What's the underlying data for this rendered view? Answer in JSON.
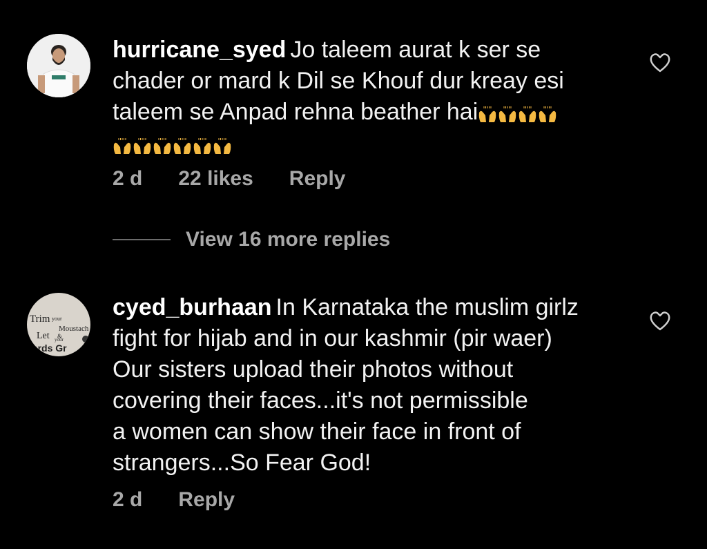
{
  "comments": [
    {
      "username": "hurricane_syed",
      "text": "Jo taleem aurat k ser se chader or mard k Dil se Khouf dur kreay esi taleem se Anpad rehna beather hai",
      "line1": "Jo taleem aurat k ser se",
      "line2": "chader or mard k Dil se Khouf dur kreay esi",
      "line3": "taleem se Anpad rehna beather hai",
      "emoji_count_line3": 4,
      "emoji_count_line4": 6,
      "emoji_name": "raising-hands-emoji",
      "time": "2 d",
      "likes": "22 likes",
      "reply_label": "Reply",
      "avatar_icon": "profile-photo-man"
    },
    {
      "username": "cyed_burhaan",
      "line1": "In Karnataka the muslim girlz",
      "line2": "fight for hijab and in our kashmir (pir waer)",
      "line3": "Our sisters upload their photos without",
      "line4": "covering their faces...it's not permissible",
      "line5": "a women can show their face in front of",
      "line6": "strangers...So Fear God!",
      "time": "2 d",
      "reply_label": "Reply",
      "avatar_text": {
        "l1": "Trim",
        "l1b": "your",
        "l2": "Moustach",
        "l3": "Let",
        "l3b": "your",
        "l3c": "&",
        "l4": "eards Gr"
      }
    }
  ],
  "view_replies_label": "View 16 more replies",
  "colors": {
    "background": "#000000",
    "text": "#f2f2f2",
    "secondary": "#a8a8a8",
    "emoji": "#f4b942"
  },
  "icons": {
    "like": "heart-outline-icon"
  }
}
